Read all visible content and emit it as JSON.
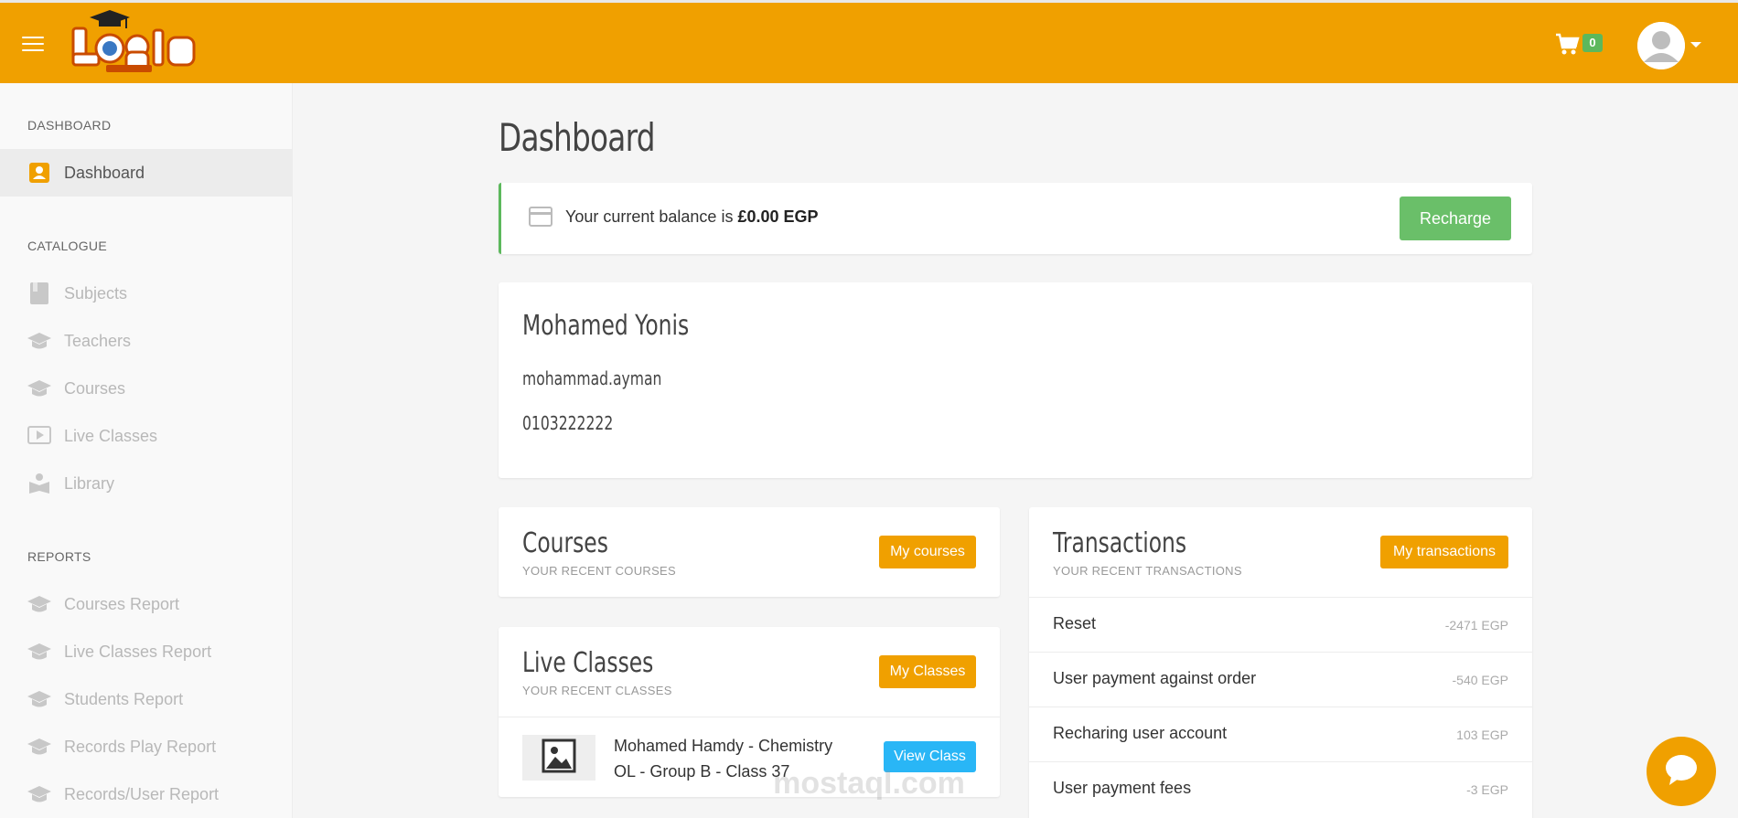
{
  "header": {
    "cart_count": "0"
  },
  "sidebar": {
    "sections": [
      {
        "label": "DASHBOARD",
        "items": [
          {
            "label": "Dashboard",
            "icon": "user-badge-icon",
            "active": true
          }
        ]
      },
      {
        "label": "CATALOGUE",
        "items": [
          {
            "label": "Subjects",
            "icon": "book-icon"
          },
          {
            "label": "Teachers",
            "icon": "graduation-cap-icon"
          },
          {
            "label": "Courses",
            "icon": "graduation-cap-icon"
          },
          {
            "label": "Live Classes",
            "icon": "play-screen-icon"
          },
          {
            "label": "Library",
            "icon": "reader-icon"
          }
        ]
      },
      {
        "label": "REPORTS",
        "items": [
          {
            "label": "Courses Report",
            "icon": "graduation-cap-icon"
          },
          {
            "label": "Live Classes Report",
            "icon": "graduation-cap-icon"
          },
          {
            "label": "Students Report",
            "icon": "graduation-cap-icon"
          },
          {
            "label": "Records Play Report",
            "icon": "graduation-cap-icon"
          },
          {
            "label": "Records/User Report",
            "icon": "graduation-cap-icon"
          }
        ]
      }
    ]
  },
  "main": {
    "title": "Dashboard",
    "balance": {
      "prefix": "Your current balance is ",
      "amount": "£0.00 EGP",
      "button": "Recharge"
    },
    "profile": {
      "name": "Mohamed Yonis",
      "username": "mohammad.ayman",
      "phone": "0103222222"
    },
    "courses": {
      "title": "Courses",
      "subtitle": "YOUR RECENT COURSES",
      "button": "My courses"
    },
    "live_classes": {
      "title": "Live Classes",
      "subtitle": "YOUR RECENT CLASSES",
      "button": "My Classes",
      "items": [
        {
          "title_line1": "Mohamed Hamdy - Chemistry",
          "title_line2": "OL - Group B - Class 37",
          "button": "View Class"
        }
      ]
    },
    "transactions": {
      "title": "Transactions",
      "subtitle": "YOUR RECENT TRANSACTIONS",
      "button": "My transactions",
      "rows": [
        {
          "label": "Reset",
          "amount": "-2471 EGP"
        },
        {
          "label": "User payment against order",
          "amount": "-540 EGP"
        },
        {
          "label": "Recharing user account",
          "amount": "103 EGP"
        },
        {
          "label": "User payment fees",
          "amount": "-3 EGP"
        }
      ]
    }
  },
  "watermark": "mostaql.com",
  "colors": {
    "header": "#f0a000",
    "accent_green": "#6abf69",
    "accent_blue": "#29b6f6"
  }
}
